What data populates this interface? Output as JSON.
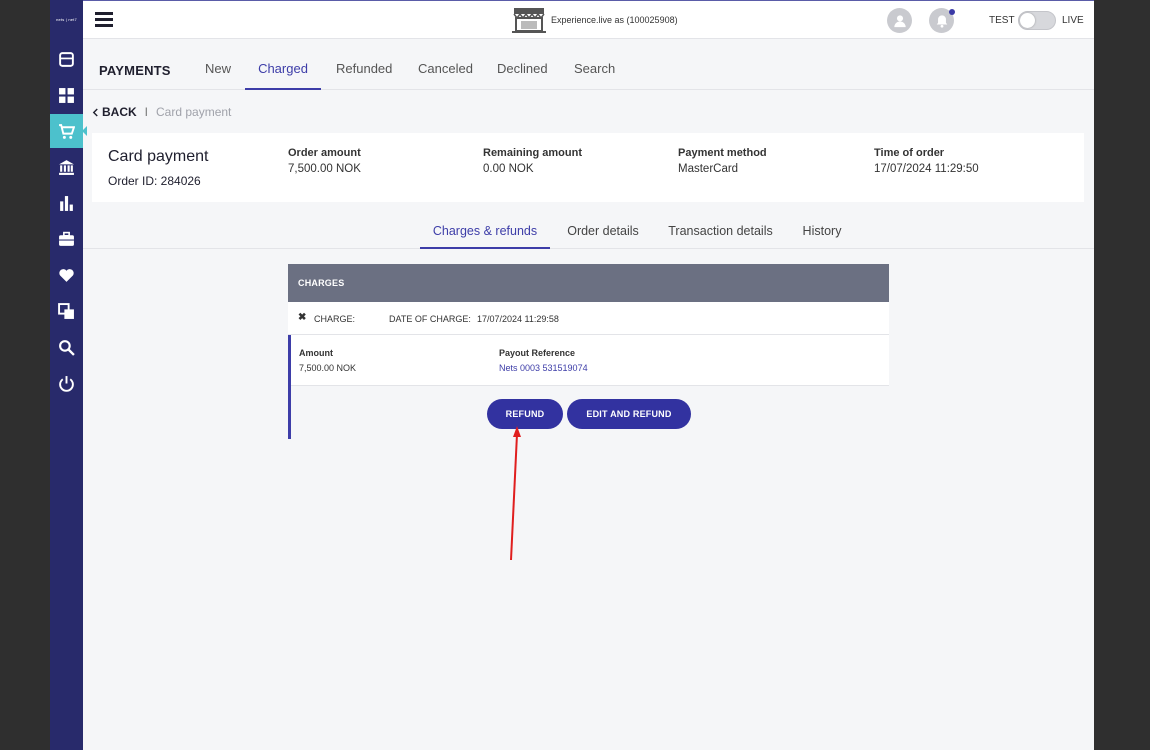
{
  "sidebar": {
    "logo": "nets | net7",
    "items": [
      {
        "icon": "store-icon"
      },
      {
        "icon": "dashboard-icon"
      },
      {
        "icon": "cart-icon",
        "active": true
      },
      {
        "icon": "bank-icon"
      },
      {
        "icon": "bar-chart-icon"
      },
      {
        "icon": "briefcase-icon"
      },
      {
        "icon": "heart-icon"
      },
      {
        "icon": "copy-icon"
      },
      {
        "icon": "search-icon"
      },
      {
        "icon": "power-icon"
      }
    ]
  },
  "topbar": {
    "store_text": "Experience.live as (100025908)",
    "test_label": "TEST",
    "live_label": "LIVE",
    "accent": "#3a3aa6"
  },
  "payments": {
    "title": "PAYMENTS",
    "tabs": [
      {
        "label": "New"
      },
      {
        "label": "Charged",
        "active": true
      },
      {
        "label": "Refunded"
      },
      {
        "label": "Canceled"
      },
      {
        "label": "Declined"
      },
      {
        "label": "Search"
      }
    ]
  },
  "breadcrumb": {
    "back": "BACK",
    "separator": "I",
    "current": "Card payment"
  },
  "summary": {
    "title": "Card payment",
    "order_id": "Order ID: 284026",
    "order_amount_label": "Order amount",
    "order_amount": "7,500.00 NOK",
    "remaining_label": "Remaining amount",
    "remaining": "0.00 NOK",
    "method_label": "Payment method",
    "method": "MasterCard",
    "time_label": "Time of order",
    "time": "17/07/2024 11:29:50"
  },
  "detail_tabs": [
    {
      "label": "Charges & refunds",
      "active": true
    },
    {
      "label": "Order details"
    },
    {
      "label": "Transaction details"
    },
    {
      "label": "History"
    }
  ],
  "charges": {
    "header": "CHARGES",
    "charge_label": "CHARGE:",
    "date_label": "DATE OF CHARGE:",
    "date_value": "17/07/2024 11:29:58",
    "amount_label": "Amount",
    "amount_value": "7,500.00 NOK",
    "ref_label": "Payout Reference",
    "ref_value": "Nets 0003 531519074",
    "refund_button": "REFUND",
    "edit_refund_button": "EDIT AND REFUND"
  },
  "annotation": {
    "arrow_color": "#e01e1e"
  }
}
